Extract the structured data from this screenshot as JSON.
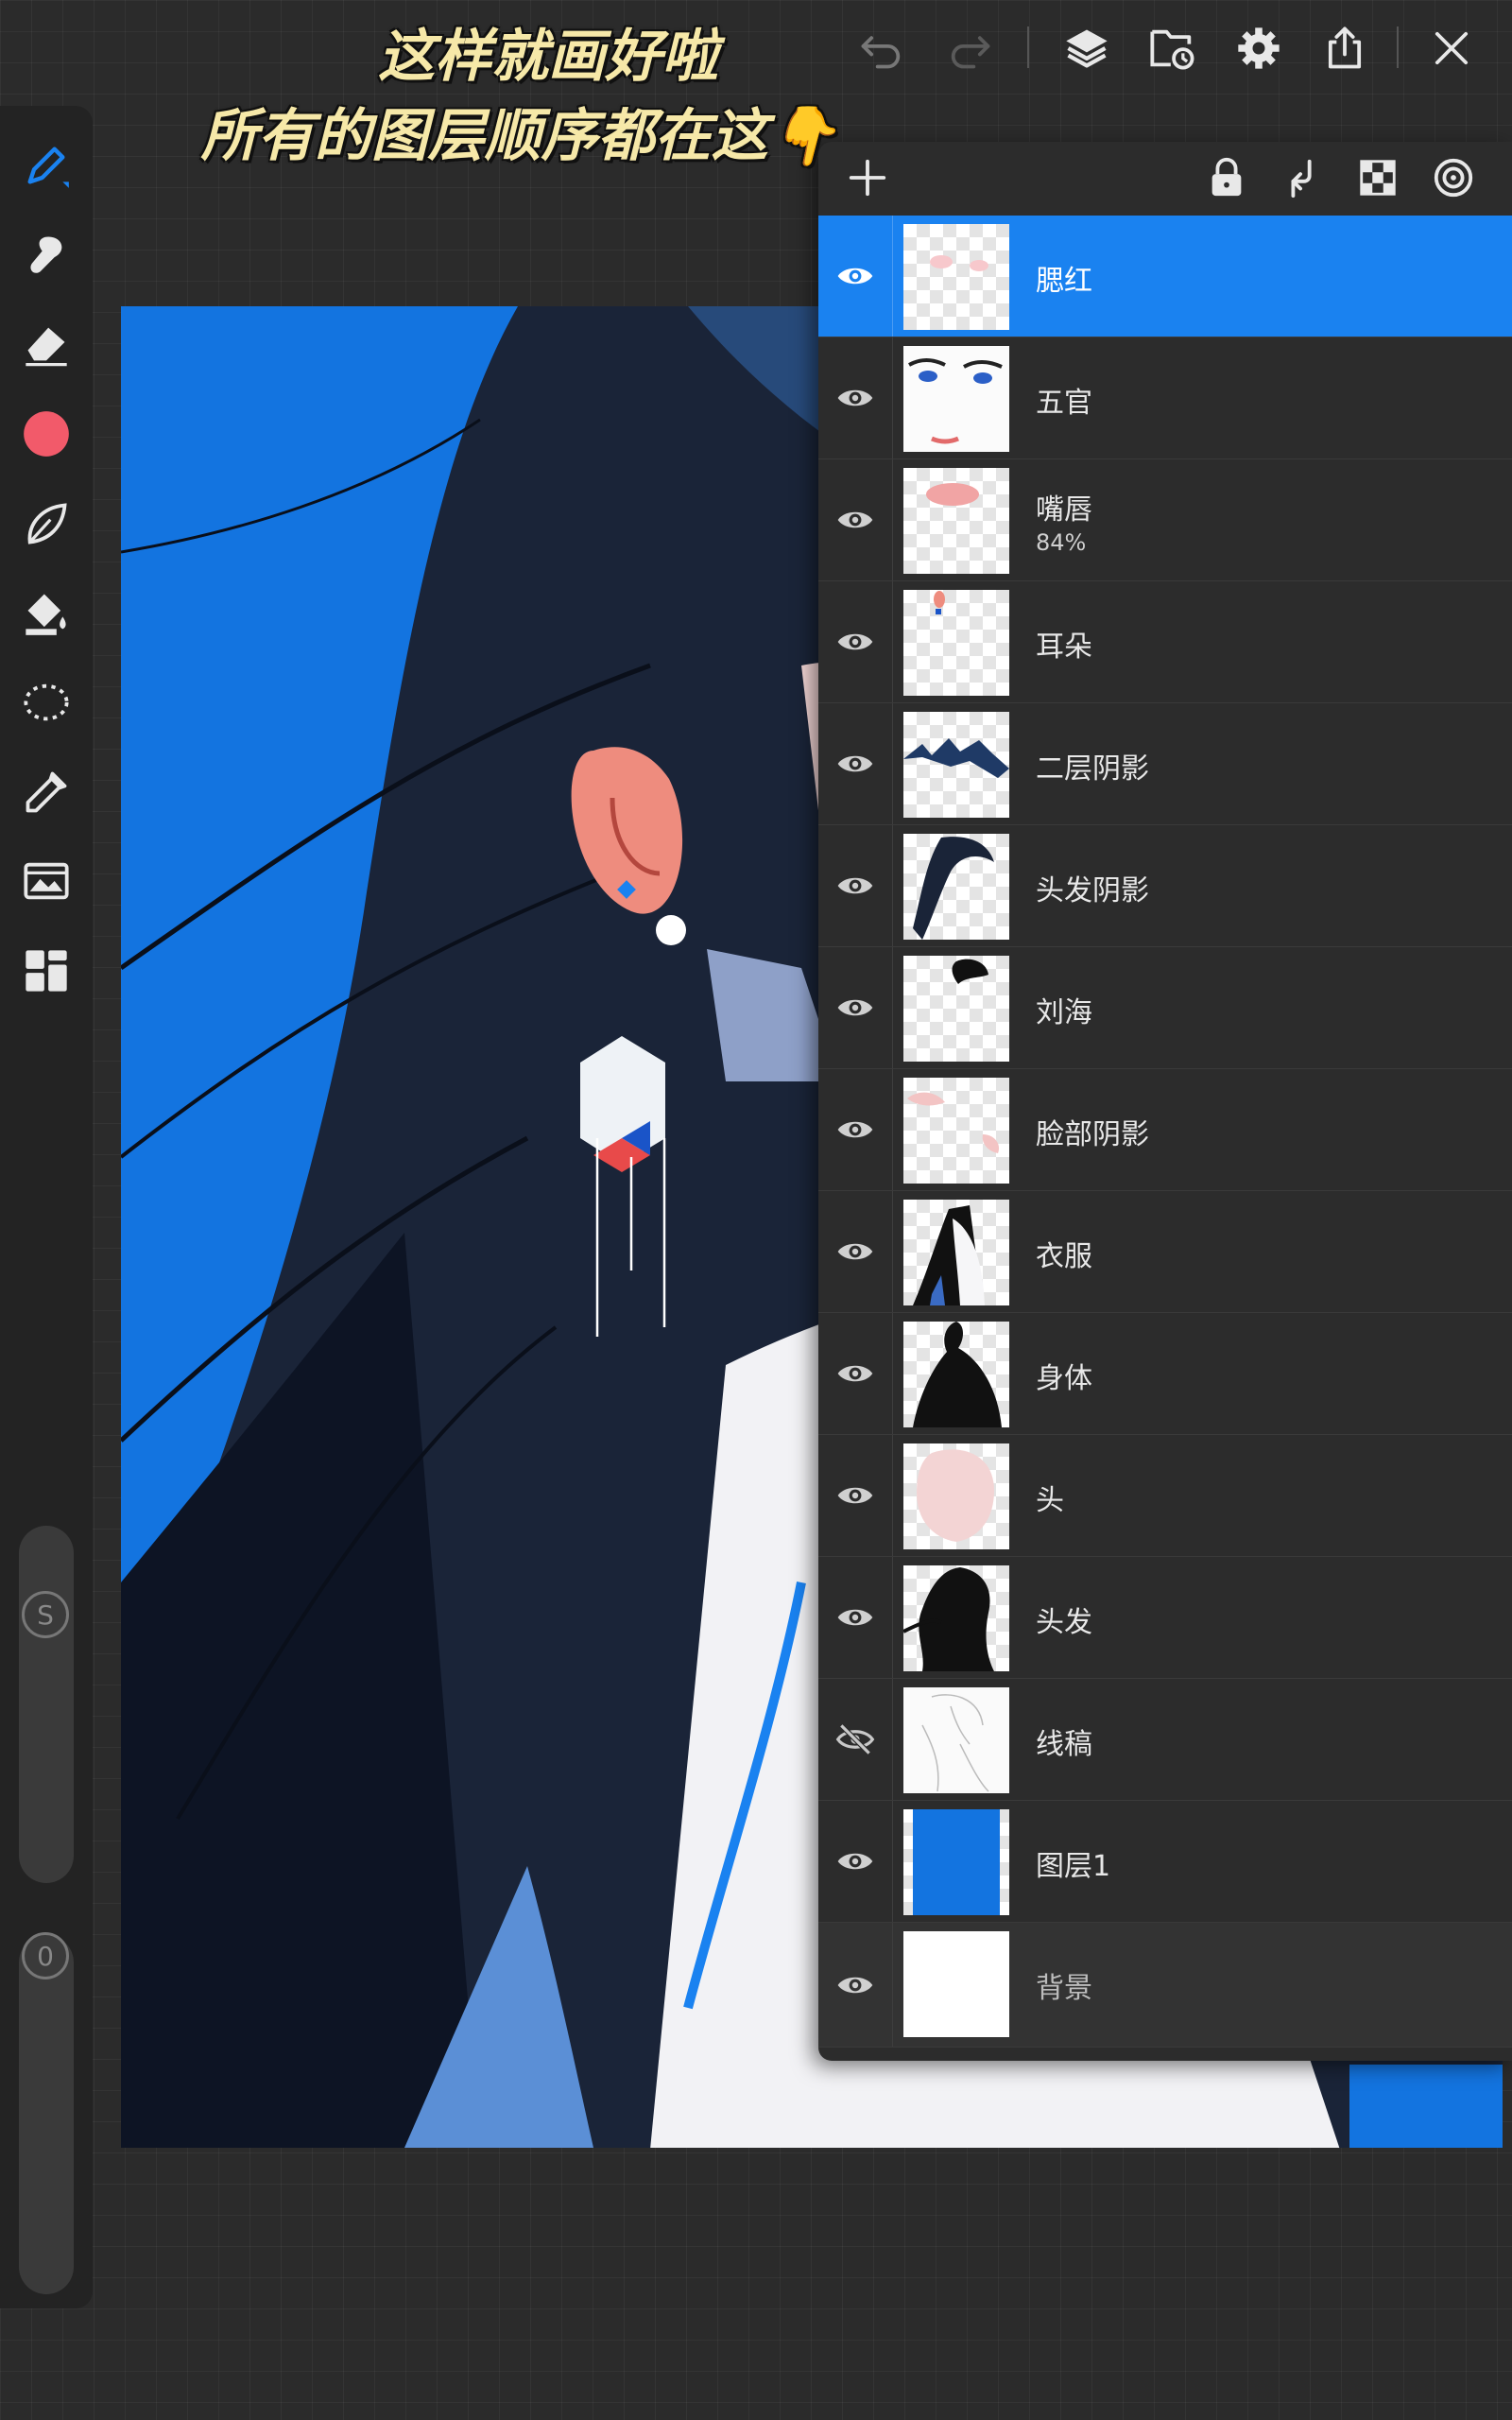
{
  "caption": {
    "line1": "这样就画好啦",
    "line2": "所有的图层顺序都在这👇"
  },
  "toolbar": {
    "icons": [
      "undo-icon",
      "redo-icon",
      "layers-icon",
      "gallery-icon",
      "settings-icon",
      "share-icon",
      "close-icon"
    ]
  },
  "tools": [
    "pen-icon",
    "smudge-icon",
    "eraser-icon",
    "color-swatch",
    "brush-library-icon",
    "fill-icon",
    "lasso-select-icon",
    "eyedropper-icon",
    "adjustments-icon",
    "grid-menu-icon"
  ],
  "colors": {
    "accent": "#1a82f0",
    "current_color": "#f25a6a",
    "canvas_bg": "#1374e0"
  },
  "sliders": {
    "size_label": "S",
    "opacity_label": "0"
  },
  "layers_panel": {
    "header_icons": [
      "add-layer-icon",
      "lock-icon",
      "merge-down-icon",
      "alpha-lock-icon",
      "target-icon"
    ],
    "layers": [
      {
        "name": "腮红",
        "selected": true,
        "visible": true
      },
      {
        "name": "五官",
        "visible": true
      },
      {
        "name": "嘴唇",
        "opacity": "84%",
        "visible": true
      },
      {
        "name": "耳朵",
        "visible": true
      },
      {
        "name": "二层阴影",
        "visible": true
      },
      {
        "name": "头发阴影",
        "visible": true
      },
      {
        "name": "刘海",
        "visible": true
      },
      {
        "name": "脸部阴影",
        "visible": true
      },
      {
        "name": "衣服",
        "visible": true
      },
      {
        "name": "身体",
        "visible": true
      },
      {
        "name": "头",
        "visible": true
      },
      {
        "name": "头发",
        "visible": true
      },
      {
        "name": "线稿",
        "visible": false
      },
      {
        "name": "图层1",
        "visible": true
      },
      {
        "name": "背景",
        "visible": true
      }
    ]
  }
}
